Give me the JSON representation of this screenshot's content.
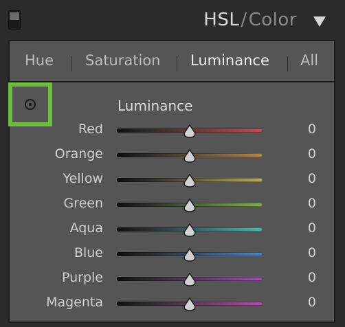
{
  "header": {
    "title_primary": "HSL",
    "title_separator": "/",
    "title_secondary": "Color"
  },
  "tabs": [
    {
      "label": "Hue",
      "active": false
    },
    {
      "label": "Saturation",
      "active": false
    },
    {
      "label": "Luminance",
      "active": true
    },
    {
      "label": "All",
      "active": false
    }
  ],
  "section": {
    "title": "Luminance",
    "target_tool_icon": "target-adjustment-icon",
    "highlight_color": "#6bbf3b"
  },
  "sliders": [
    {
      "label": "Red",
      "value": "0",
      "level": 0.5,
      "color": "#c24a52"
    },
    {
      "label": "Orange",
      "value": "0",
      "level": 0.5,
      "color": "#b7874c"
    },
    {
      "label": "Yellow",
      "value": "0",
      "level": 0.5,
      "color": "#b8ad5a"
    },
    {
      "label": "Green",
      "value": "0",
      "level": 0.5,
      "color": "#7fae4c"
    },
    {
      "label": "Aqua",
      "value": "0",
      "level": 0.5,
      "color": "#4bb3b0"
    },
    {
      "label": "Blue",
      "value": "0",
      "level": 0.5,
      "color": "#4a86c6"
    },
    {
      "label": "Purple",
      "value": "0",
      "level": 0.5,
      "color": "#9c4fb2"
    },
    {
      "label": "Magenta",
      "value": "0",
      "level": 0.5,
      "color": "#b44aa6"
    }
  ]
}
